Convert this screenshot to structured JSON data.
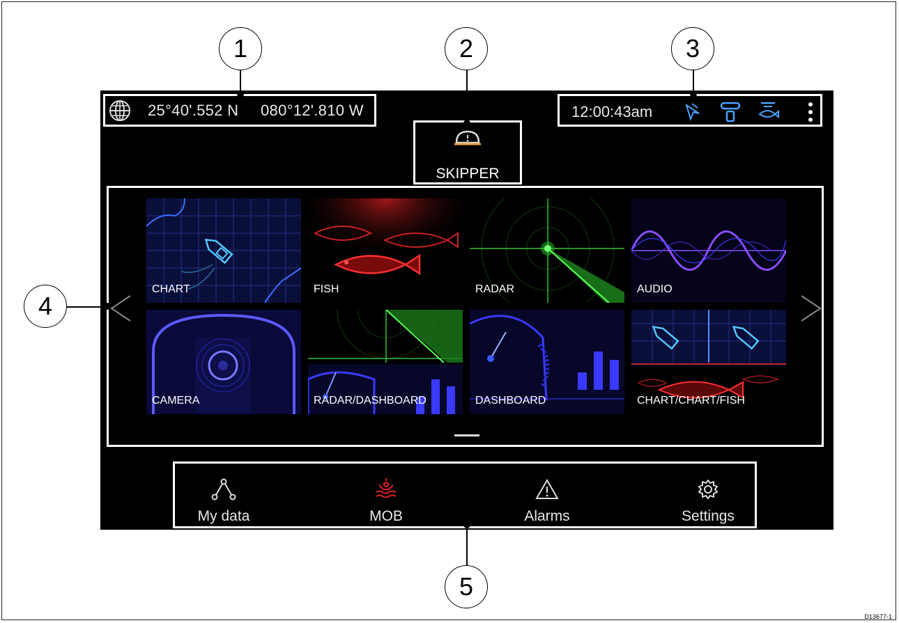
{
  "status_bar": {
    "latitude": "25°40'.552 N",
    "longitude": "080°12'.810 W",
    "time": "12:00:43am"
  },
  "profile": {
    "name": "SKIPPER"
  },
  "apps": [
    {
      "label": "CHART"
    },
    {
      "label": "FISH"
    },
    {
      "label": "RADAR"
    },
    {
      "label": "AUDIO"
    },
    {
      "label": "CAMERA"
    },
    {
      "label": "RADAR/DASHBOARD"
    },
    {
      "label": "DASHBOARD"
    },
    {
      "label": "CHART/CHART/FISH"
    }
  ],
  "bottom_bar": {
    "my_data": "My data",
    "mob": "MOB",
    "alarms": "Alarms",
    "settings": "Settings"
  },
  "callouts": [
    "1",
    "2",
    "3",
    "4",
    "5"
  ],
  "drawing_code": "D13677-1",
  "colors": {
    "mob": "#e41e1e",
    "status_icons": "#4aa3ff",
    "profile_accent": "#e6a23c"
  },
  "icons": [
    "globe-icon",
    "gps-icon",
    "autopilot-icon",
    "sonar-icon",
    "more-vert-icon",
    "skipper-icon",
    "my-data-icon",
    "mob-icon",
    "alarm-icon",
    "settings-icon"
  ]
}
